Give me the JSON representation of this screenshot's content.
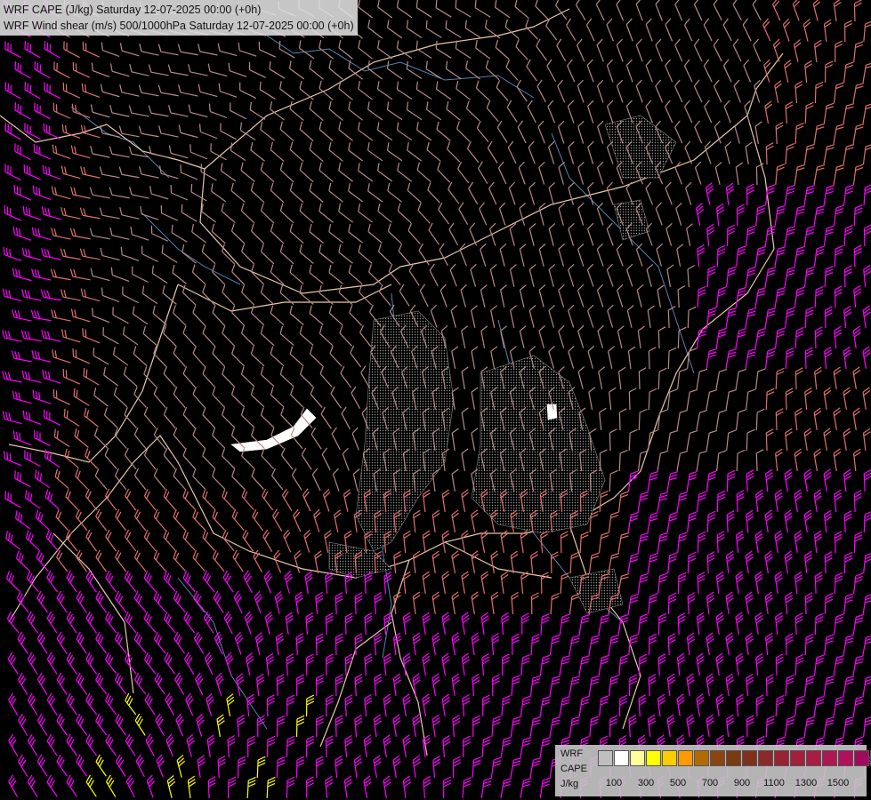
{
  "titles": {
    "line1": "WRF CAPE (J/kg) Saturday 12-07-2025 00:00 (+0h)",
    "line2": "WRF Wind shear (m/s) 500/1000hPa Saturday 12-07-2025 00:00 (+0h)"
  },
  "legend": {
    "label_model": "WRF",
    "label_field": "CAPE",
    "label_unit": "J/kg",
    "colors": [
      "#bfbfbf",
      "#ffffff",
      "#ffff99",
      "#ffff00",
      "#ffcc00",
      "#ff9900",
      "#b36b00",
      "#8b4513",
      "#7a3b10",
      "#80301a",
      "#8c2a2a",
      "#992233",
      "#a3203c",
      "#a81c46",
      "#b01652",
      "#b0105c",
      "#a00a5c",
      "#8a005a"
    ],
    "tick_labels": [
      "100",
      "300",
      "500",
      "700",
      "900",
      "1100",
      "1300",
      "1500"
    ]
  },
  "colors": {
    "background": "#000000",
    "borders": "#e8c8a8",
    "rivers": "#5a82b4",
    "barb_low": "#b88a8a",
    "barb_mid": "#e07070",
    "barb_high": "#ff00ff",
    "barb_extreme": "#ffff00"
  }
}
